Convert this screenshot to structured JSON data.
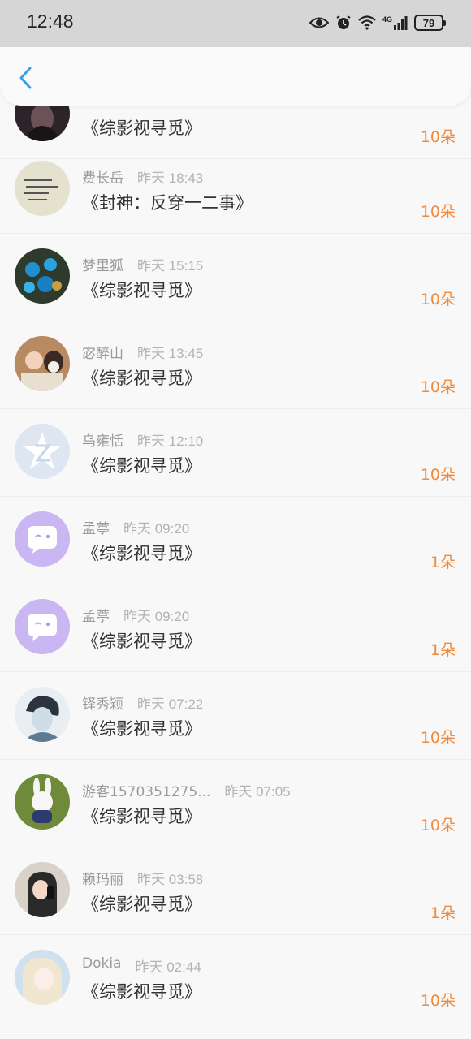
{
  "status_bar": {
    "time": "12:48",
    "battery": "79",
    "network": "4G",
    "icons": [
      "eye-icon",
      "alarm-icon",
      "wifi-icon",
      "signal-icon",
      "battery-icon"
    ]
  },
  "nav": {
    "back_icon": "chevron-left-icon",
    "accent_color": "#3a9ee8"
  },
  "accent_color": "#f08a3c",
  "records": [
    {
      "name": "",
      "time": "",
      "title": "《综影视寻觅》",
      "amount": "10朵",
      "avatar": "dark-portrait"
    },
    {
      "name": "费长岳",
      "time": "昨天 18:43",
      "title": "《封神：反穿一二事》",
      "amount": "10朵",
      "avatar": "handwriting-note"
    },
    {
      "name": "梦里狐",
      "time": "昨天 15:15",
      "title": "《综影视寻觅》",
      "amount": "10朵",
      "avatar": "blue-flowers"
    },
    {
      "name": "宓醉山",
      "time": "昨天 13:45",
      "title": "《综影视寻觅》",
      "amount": "10朵",
      "avatar": "child-with-dog"
    },
    {
      "name": "乌雍恬",
      "time": "昨天 12:10",
      "title": "《综影视寻觅》",
      "amount": "10朵",
      "avatar": "default-qq-logo"
    },
    {
      "name": "孟葶",
      "time": "昨天 09:20",
      "title": "《综影视寻觅》",
      "amount": "1朵",
      "avatar": "purple-chat-bubble"
    },
    {
      "name": "孟葶",
      "time": "昨天 09:20",
      "title": "《综影视寻觅》",
      "amount": "1朵",
      "avatar": "purple-chat-bubble"
    },
    {
      "name": "铎秀颖",
      "time": "昨天 07:22",
      "title": "《综影视寻觅》",
      "amount": "10朵",
      "avatar": "anime-character"
    },
    {
      "name": "游客1570351275...",
      "time": "昨天 07:05",
      "title": "《综影视寻觅》",
      "amount": "10朵",
      "avatar": "white-rabbit"
    },
    {
      "name": "赖玛丽",
      "time": "昨天 03:58",
      "title": "《综影视寻觅》",
      "amount": "1朵",
      "avatar": "girl-selfie"
    },
    {
      "name": "Dokia",
      "time": "昨天 02:44",
      "title": "《综影视寻觅》",
      "amount": "10朵",
      "avatar": "anime-girl-blonde"
    }
  ]
}
